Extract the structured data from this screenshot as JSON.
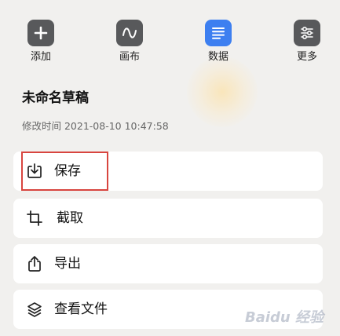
{
  "toolbar": {
    "items": [
      {
        "label": "添加",
        "icon": "plus-icon"
      },
      {
        "label": "画布",
        "icon": "wave-icon"
      },
      {
        "label": "数据",
        "icon": "list-icon",
        "active": true
      },
      {
        "label": "更多",
        "icon": "sliders-icon"
      }
    ]
  },
  "document": {
    "title": "未命名草稿",
    "modified": "修改时间 2021-08-10 10:47:58"
  },
  "menu": {
    "items": [
      {
        "label": "保存",
        "icon": "save-icon"
      },
      {
        "label": "截取",
        "icon": "crop-icon"
      },
      {
        "label": "导出",
        "icon": "share-icon"
      },
      {
        "label": "查看文件",
        "icon": "layers-icon"
      }
    ]
  },
  "watermark": {
    "text": "Baidu 经验"
  },
  "colors": {
    "accent": "#3d7ff0",
    "icon_bg": "#58595b",
    "highlight": "#d8453f"
  }
}
